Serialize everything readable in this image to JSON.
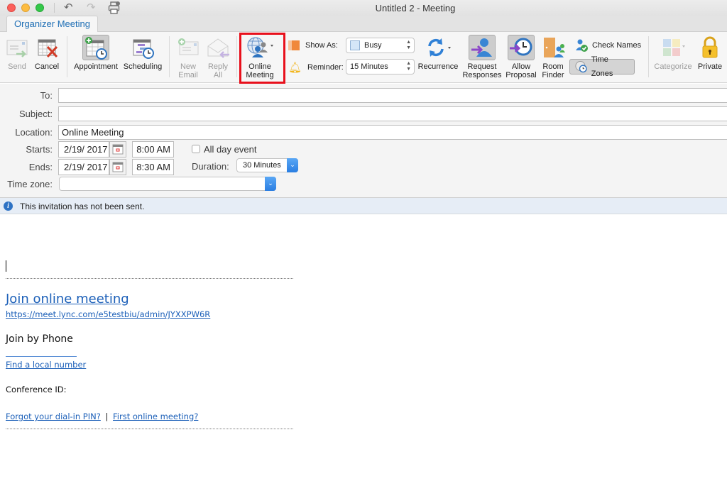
{
  "window": {
    "title": "Untitled 2 - Meeting",
    "toolbar_icons": [
      "undo-icon",
      "redo-icon",
      "print-icon"
    ]
  },
  "tabs": [
    {
      "label": "Organizer Meeting",
      "active": true
    }
  ],
  "ribbon": {
    "send": {
      "label": "Send",
      "enabled": false
    },
    "cancel": {
      "label": "Cancel"
    },
    "appointment": {
      "label": "Appointment",
      "pressed": true
    },
    "scheduling": {
      "label": "Scheduling"
    },
    "new_email": {
      "label_line1": "New",
      "label_line2": "Email",
      "enabled": false
    },
    "reply_all": {
      "label_line1": "Reply",
      "label_line2": "All",
      "enabled": false
    },
    "online_meeting": {
      "label_line1": "Online",
      "label_line2": "Meeting",
      "highlighted": true
    },
    "show_as": {
      "label": "Show As:",
      "value": "Busy"
    },
    "reminder": {
      "label": "Reminder:",
      "value": "15 Minutes"
    },
    "recurrence": {
      "label": "Recurrence"
    },
    "request_responses": {
      "label_line1": "Request",
      "label_line2": "Responses",
      "pressed": true
    },
    "allow_proposal": {
      "label_line1": "Allow",
      "label_line2": "Proposal",
      "pressed": true
    },
    "room_finder": {
      "label_line1": "Room",
      "label_line2": "Finder"
    },
    "check_names": {
      "label": "Check Names"
    },
    "time_zones": {
      "label": "Time Zones",
      "pressed": true
    },
    "categorize": {
      "label": "Categorize",
      "enabled": false
    },
    "private": {
      "label": "Private"
    }
  },
  "form": {
    "to": {
      "label": "To:",
      "value": ""
    },
    "subject": {
      "label": "Subject:",
      "value": ""
    },
    "location": {
      "label": "Location:",
      "value": "Online Meeting"
    },
    "starts": {
      "label": "Starts:",
      "date": "2/19/ 2017",
      "time": "8:00 AM"
    },
    "ends": {
      "label": "Ends:",
      "date": "2/19/ 2017",
      "time": "8:30 AM"
    },
    "all_day": {
      "label": "All day event",
      "checked": false
    },
    "duration": {
      "label": "Duration:",
      "value": "30 Minutes"
    },
    "time_zone": {
      "label": "Time zone:",
      "value": ""
    }
  },
  "infobar": {
    "message": "This invitation has not been sent."
  },
  "body": {
    "join_online": "Join online meeting",
    "meeting_url": "https://meet.lync.com/e5testbiu/admin/JYXXPW6R",
    "join_phone": "Join by Phone",
    "find_local": "Find a local number",
    "conference_id": "Conference ID:",
    "forgot_pin": "Forgot your dial-in PIN?",
    "separator": "|",
    "first_meeting": "First online meeting?"
  },
  "colors": {
    "accent": "#1f6fb5",
    "highlight": "#e8101c",
    "link": "#1b5fb8",
    "infobar_bg": "#e6edf6"
  }
}
